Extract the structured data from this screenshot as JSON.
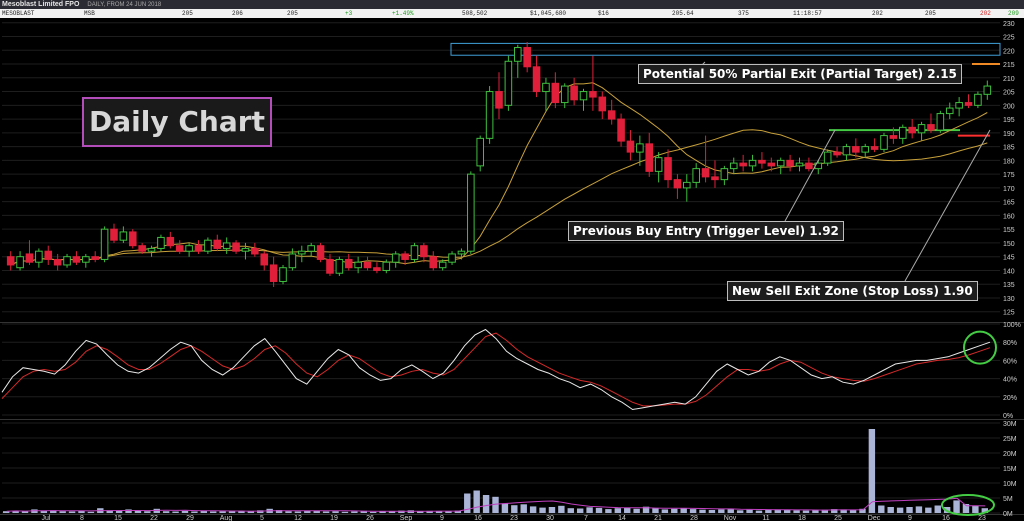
{
  "header": {
    "instrument": "Mesoblast Limited FPO",
    "meta": "DAILY, FROM 24 JUN 2018"
  },
  "quote": {
    "name": "MESOBLAST",
    "code": "MSB",
    "bid": "205",
    "ask": "206",
    "last": "205",
    "change": "+3",
    "pct_change": "+1.49%",
    "volume": "508,502",
    "value": "$1,045,680",
    "trades": "$16",
    "vwap": "205.64",
    "count": "375",
    "time": "11:18:57",
    "open": "202",
    "high": "205",
    "low": "202",
    "close": "209"
  },
  "labels": {
    "daily_chart": "Daily Chart",
    "partial_target": "Potential 50% Partial Exit (Partial Target) 2.15",
    "buy_entry": "Previous Buy Entry (Trigger Level) 1.92",
    "stop_loss": "New Sell Exit Zone (Stop Loss) 1.90"
  },
  "colors": {
    "up": "#3fbf3f",
    "down": "#e0203a",
    "ma_fast": "#c7a03a",
    "ma_slow": "#c7a03a",
    "stoch_k": "#e8e8e8",
    "stoch_d": "#d42a2a",
    "volume": "#a9b4d6",
    "highlight": "#44cc44",
    "target_line": "#f08a24",
    "stop_line": "#ff3030",
    "box": "#3fa0d8"
  },
  "chart_data": [
    {
      "type": "candlestick",
      "title": "Price",
      "yticks": [
        125,
        130,
        135,
        140,
        145,
        150,
        155,
        160,
        165,
        170,
        175,
        180,
        185,
        190,
        195,
        200,
        205,
        210,
        215,
        220,
        225,
        230
      ],
      "ylim": [
        122,
        231
      ],
      "xticks": [
        "Jul",
        "8",
        "15",
        "22",
        "29",
        "Aug",
        "5",
        "12",
        "19",
        "26",
        "Sep",
        "9",
        "16",
        "23",
        "30",
        "7",
        "14",
        "21",
        "28",
        "Nov",
        "11",
        "18",
        "25",
        "Dec",
        "9",
        "16",
        "23"
      ],
      "levels": {
        "partial_target": 215,
        "buy_entry": 191,
        "stop_loss": 189
      },
      "ohlc": [
        [
          145,
          147,
          140,
          142
        ],
        [
          141,
          147,
          140,
          145
        ],
        [
          146,
          151,
          142,
          143
        ],
        [
          143,
          148,
          141,
          147
        ],
        [
          147,
          149,
          142,
          144
        ],
        [
          144,
          146,
          140,
          142
        ],
        [
          142,
          146,
          141,
          145
        ],
        [
          145,
          147,
          142,
          143
        ],
        [
          143,
          146,
          141,
          145
        ],
        [
          145,
          147,
          143,
          144
        ],
        [
          144,
          156,
          143,
          155
        ],
        [
          155,
          157,
          150,
          151
        ],
        [
          151,
          156,
          150,
          154
        ],
        [
          154,
          155,
          148,
          149
        ],
        [
          149,
          150,
          146,
          147
        ],
        [
          147,
          149,
          145,
          148
        ],
        [
          148,
          153,
          147,
          152
        ],
        [
          152,
          154,
          148,
          149
        ],
        [
          149,
          151,
          146,
          147
        ],
        [
          147,
          150,
          145,
          149
        ],
        [
          149,
          151,
          146,
          147
        ],
        [
          147,
          152,
          146,
          151
        ],
        [
          151,
          153,
          147,
          148
        ],
        [
          148,
          152,
          146,
          150
        ],
        [
          150,
          151,
          146,
          147
        ],
        [
          147,
          150,
          144,
          148
        ],
        [
          148,
          150,
          145,
          146
        ],
        [
          146,
          147,
          140,
          142
        ],
        [
          142,
          145,
          134,
          136
        ],
        [
          136,
          142,
          135,
          141
        ],
        [
          141,
          148,
          140,
          146
        ],
        [
          146,
          149,
          143,
          147
        ],
        [
          147,
          150,
          145,
          149
        ],
        [
          149,
          150,
          143,
          144
        ],
        [
          144,
          146,
          138,
          139
        ],
        [
          139,
          145,
          138,
          144
        ],
        [
          144,
          146,
          140,
          141
        ],
        [
          141,
          145,
          139,
          143
        ],
        [
          143,
          145,
          140,
          141
        ],
        [
          141,
          143,
          139,
          140
        ],
        [
          140,
          144,
          139,
          143
        ],
        [
          143,
          147,
          141,
          146
        ],
        [
          146,
          147,
          142,
          144
        ],
        [
          144,
          150,
          143,
          149
        ],
        [
          149,
          150,
          143,
          145
        ],
        [
          145,
          147,
          140,
          141
        ],
        [
          141,
          144,
          140,
          143
        ],
        [
          143,
          147,
          142,
          146
        ],
        [
          146,
          148,
          144,
          147
        ],
        [
          147,
          176,
          146,
          175
        ],
        [
          178,
          189,
          176,
          188
        ],
        [
          188,
          207,
          186,
          205
        ],
        [
          205,
          212,
          195,
          199
        ],
        [
          200,
          218,
          198,
          216
        ],
        [
          216,
          222,
          210,
          221
        ],
        [
          221,
          223,
          212,
          214
        ],
        [
          214,
          218,
          203,
          205
        ],
        [
          205,
          210,
          198,
          208
        ],
        [
          208,
          212,
          199,
          201
        ],
        [
          201,
          208,
          199,
          207
        ],
        [
          207,
          210,
          200,
          202
        ],
        [
          202,
          206,
          198,
          205
        ],
        [
          205,
          218,
          198,
          203
        ],
        [
          203,
          205,
          195,
          198
        ],
        [
          198,
          202,
          193,
          195
        ],
        [
          195,
          197,
          185,
          187
        ],
        [
          187,
          191,
          180,
          183
        ],
        [
          183,
          189,
          178,
          186
        ],
        [
          186,
          190,
          174,
          176
        ],
        [
          176,
          183,
          172,
          181
        ],
        [
          181,
          184,
          170,
          173
        ],
        [
          173,
          175,
          166,
          170
        ],
        [
          170,
          175,
          165,
          172
        ],
        [
          172,
          179,
          170,
          177
        ],
        [
          177,
          189,
          172,
          174
        ],
        [
          174,
          180,
          170,
          173
        ],
        [
          173,
          178,
          171,
          177
        ],
        [
          177,
          181,
          175,
          179
        ],
        [
          179,
          182,
          176,
          178
        ],
        [
          178,
          182,
          176,
          180
        ],
        [
          180,
          183,
          177,
          179
        ],
        [
          179,
          181,
          176,
          178
        ],
        [
          178,
          181,
          175,
          180
        ],
        [
          180,
          182,
          176,
          178
        ],
        [
          178,
          181,
          176,
          179
        ],
        [
          179,
          181,
          176,
          177
        ],
        [
          177,
          180,
          175,
          179
        ],
        [
          179,
          184,
          178,
          183
        ],
        [
          183,
          185,
          181,
          182
        ],
        [
          182,
          186,
          180,
          185
        ],
        [
          185,
          188,
          181,
          183
        ],
        [
          183,
          186,
          181,
          185
        ],
        [
          185,
          188,
          183,
          184
        ],
        [
          184,
          190,
          183,
          189
        ],
        [
          189,
          192,
          186,
          188
        ],
        [
          188,
          193,
          186,
          192
        ],
        [
          192,
          195,
          188,
          190
        ],
        [
          190,
          194,
          187,
          193
        ],
        [
          193,
          197,
          190,
          191
        ],
        [
          191,
          198,
          190,
          197
        ],
        [
          197,
          201,
          195,
          199
        ],
        [
          199,
          203,
          196,
          201
        ],
        [
          201,
          204,
          199,
          200
        ],
        [
          200,
          205,
          199,
          204
        ],
        [
          204,
          209,
          202,
          207
        ]
      ]
    },
    {
      "type": "line",
      "title": "Stochastic",
      "yticks": [
        "0%",
        "20%",
        "40%",
        "60%",
        "80%",
        "100%"
      ],
      "ylim": [
        0,
        100
      ],
      "series": [
        {
          "values": [
            25,
            42,
            52,
            50,
            48,
            45,
            55,
            70,
            82,
            78,
            66,
            55,
            48,
            46,
            52,
            62,
            72,
            80,
            76,
            60,
            50,
            44,
            52,
            64,
            76,
            84,
            70,
            55,
            40,
            34,
            48,
            62,
            72,
            66,
            52,
            44,
            38,
            40,
            50,
            55,
            48,
            40,
            46,
            60,
            76,
            88,
            94,
            84,
            70,
            62,
            56,
            50,
            46,
            40,
            36,
            30,
            34,
            28,
            20,
            14,
            6,
            8,
            10,
            12,
            14,
            12,
            20,
            34,
            48,
            56,
            50,
            44,
            48,
            58,
            64,
            60,
            52,
            44,
            40,
            42,
            36,
            34,
            38,
            44,
            50,
            56,
            58,
            60,
            60,
            62,
            64,
            68,
            72,
            76,
            80
          ]
        },
        {
          "values": [
            18,
            30,
            42,
            48,
            50,
            48,
            50,
            58,
            70,
            76,
            72,
            64,
            55,
            50,
            50,
            56,
            64,
            72,
            76,
            70,
            62,
            54,
            50,
            54,
            62,
            72,
            76,
            68,
            56,
            46,
            42,
            50,
            60,
            66,
            62,
            54,
            46,
            42,
            44,
            48,
            50,
            46,
            44,
            50,
            62,
            74,
            86,
            90,
            82,
            72,
            64,
            58,
            52,
            46,
            42,
            38,
            36,
            32,
            26,
            20,
            14,
            10,
            10,
            11,
            12,
            12,
            15,
            22,
            32,
            42,
            50,
            50,
            48,
            50,
            56,
            60,
            58,
            52,
            46,
            42,
            40,
            38,
            37,
            40,
            44,
            48,
            52,
            56,
            58,
            60,
            61,
            63,
            66,
            70,
            74
          ]
        }
      ]
    },
    {
      "type": "bar",
      "title": "Volume",
      "yticks": [
        "0M",
        "5M",
        "10M",
        "15M",
        "20M",
        "25M",
        "30M"
      ],
      "ylim": [
        0,
        30
      ],
      "values": [
        0.6,
        0.8,
        0.5,
        1.2,
        0.7,
        0.9,
        0.6,
        0.5,
        0.7,
        0.4,
        1.6,
        0.9,
        0.7,
        1.2,
        0.8,
        0.6,
        1.4,
        0.6,
        0.5,
        0.7,
        0.5,
        0.8,
        0.5,
        0.6,
        0.6,
        0.5,
        0.7,
        0.9,
        1.4,
        1.0,
        0.6,
        0.5,
        0.7,
        0.8,
        0.5,
        0.6,
        0.4,
        0.5,
        0.7,
        0.4,
        0.5,
        0.6,
        0.8,
        0.9,
        0.6,
        0.7,
        0.5,
        0.6,
        0.8,
        6.5,
        7.5,
        6.0,
        5.4,
        3.2,
        2.6,
        2.9,
        2.2,
        1.8,
        2.0,
        2.4,
        1.6,
        1.5,
        1.9,
        1.7,
        1.3,
        1.6,
        1.8,
        1.4,
        2.1,
        1.6,
        1.2,
        1.4,
        1.5,
        1.3,
        1.1,
        1.0,
        1.2,
        1.3,
        0.9,
        1.1,
        0.8,
        1.0,
        1.2,
        1.0,
        0.9,
        0.8,
        1.0,
        1.1,
        1.3,
        1.2,
        1.0,
        1.4,
        28.0,
        2.5,
        2.0,
        1.8,
        2.0,
        2.2,
        1.8,
        2.5,
        2.0,
        4.2,
        3.0,
        2.5,
        1.6
      ]
    }
  ]
}
